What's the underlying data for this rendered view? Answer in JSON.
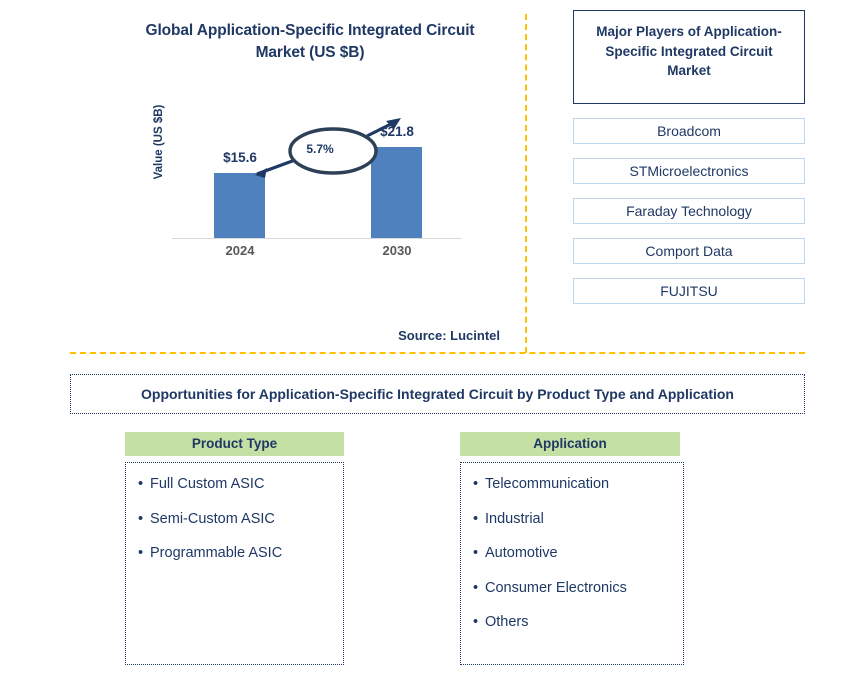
{
  "chart_panel": {
    "title": "Global Application-Specific Integrated Circuit Market (US $B)",
    "title_line1": "Global Application-Specific Integrated Circuit",
    "title_line2": "Market (US $B)",
    "source": "Source: Lucintel"
  },
  "chart_data": {
    "type": "bar",
    "title": "Global Application-Specific Integrated Circuit Market (US $B)",
    "xlabel": "",
    "ylabel": "Value (US $B)",
    "categories": [
      "2024",
      "2030"
    ],
    "values": [
      15.6,
      21.8
    ],
    "value_labels": [
      "$15.6",
      "$21.8"
    ],
    "ylim": [
      0,
      25
    ],
    "grid": false,
    "legend": null,
    "bar_color": "#4E81BD",
    "annotations": [
      {
        "type": "cagr-callout",
        "label": "5.7%",
        "from": "2024",
        "to": "2030"
      }
    ]
  },
  "players": {
    "header": "Major Players of Application-Specific Integrated Circuit Market",
    "items": [
      {
        "label": "Broadcom"
      },
      {
        "label": "STMicroelectronics"
      },
      {
        "label": "Faraday Technology"
      },
      {
        "label": "Comport Data"
      },
      {
        "label": "FUJITSU"
      }
    ]
  },
  "opportunities": {
    "banner": "Opportunities for Application-Specific Integrated Circuit by Product Type and Application",
    "product_type": {
      "header": "Product Type",
      "bullet": "•",
      "items": [
        {
          "label": "Full Custom ASIC"
        },
        {
          "label": "Semi-Custom ASIC"
        },
        {
          "label": "Programmable ASIC"
        }
      ]
    },
    "application": {
      "header": "Application",
      "bullet": "•",
      "items": [
        {
          "label": "Telecommunication"
        },
        {
          "label": "Industrial"
        },
        {
          "label": "Automotive"
        },
        {
          "label": "Consumer Electronics"
        },
        {
          "label": "Others"
        }
      ]
    }
  },
  "colors": {
    "navy": "#1F3864",
    "bar_blue": "#4E81BD",
    "divider_orange": "#FFC000",
    "header_green": "#C5E0A5",
    "light_blue_border": "#BDD7EE",
    "tick_gray": "#595959"
  }
}
